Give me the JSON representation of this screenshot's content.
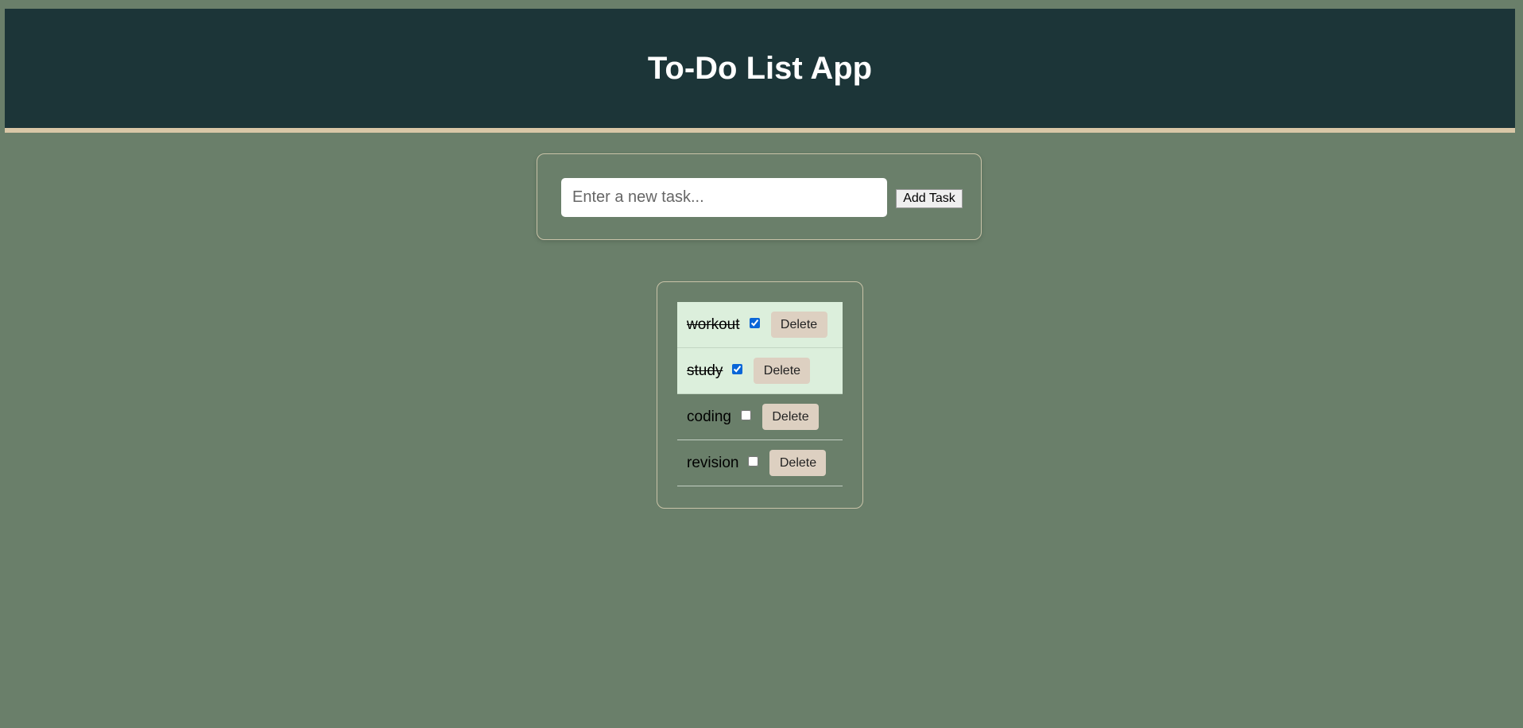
{
  "app": {
    "title": "To-Do List App"
  },
  "input": {
    "placeholder": "Enter a new task...",
    "value": "",
    "add_label": "Add Task"
  },
  "tasks": [
    {
      "text": "workout",
      "done": true,
      "delete_label": "Delete"
    },
    {
      "text": "study",
      "done": true,
      "delete_label": "Delete"
    },
    {
      "text": "coding",
      "done": false,
      "delete_label": "Delete"
    },
    {
      "text": "revision",
      "done": false,
      "delete_label": "Delete"
    }
  ],
  "colors": {
    "background": "#6a7f6a",
    "header": "#1c3538",
    "header_border": "#d9c7a7",
    "done_row": "#dcefdc",
    "delete_button": "#ddd0c1"
  }
}
